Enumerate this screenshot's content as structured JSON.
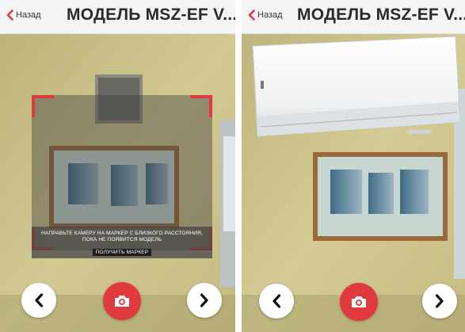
{
  "screens": [
    {
      "header": {
        "back_label": "Назад",
        "title": "МОДЕЛЬ MSZ-EF V..."
      },
      "overlay": {
        "instruction_line1": "НАПРАВЬТЕ КАМЕРУ НА МАРКЕР С БЛИЗКОГО РАССТОЯНИЯ,",
        "instruction_line2": "ПОКА НЕ ПОЯВИТСЯ МОДЕЛЬ",
        "get_marker_label": "ПОЛУЧИТЬ МАРКЕР"
      },
      "controls": {
        "prev_icon": "chevron-left-icon",
        "capture_icon": "camera-icon",
        "next_icon": "chevron-right-icon"
      }
    },
    {
      "header": {
        "back_label": "Назад",
        "title": "МОДЕЛЬ MSZ-EF V..."
      },
      "controls": {
        "prev_icon": "chevron-left-icon",
        "capture_icon": "camera-icon",
        "next_icon": "chevron-right-icon"
      }
    }
  ],
  "colors": {
    "accent": "#e0393e",
    "header_bg": "#f4f4f4",
    "wall": "#c9c08e"
  }
}
